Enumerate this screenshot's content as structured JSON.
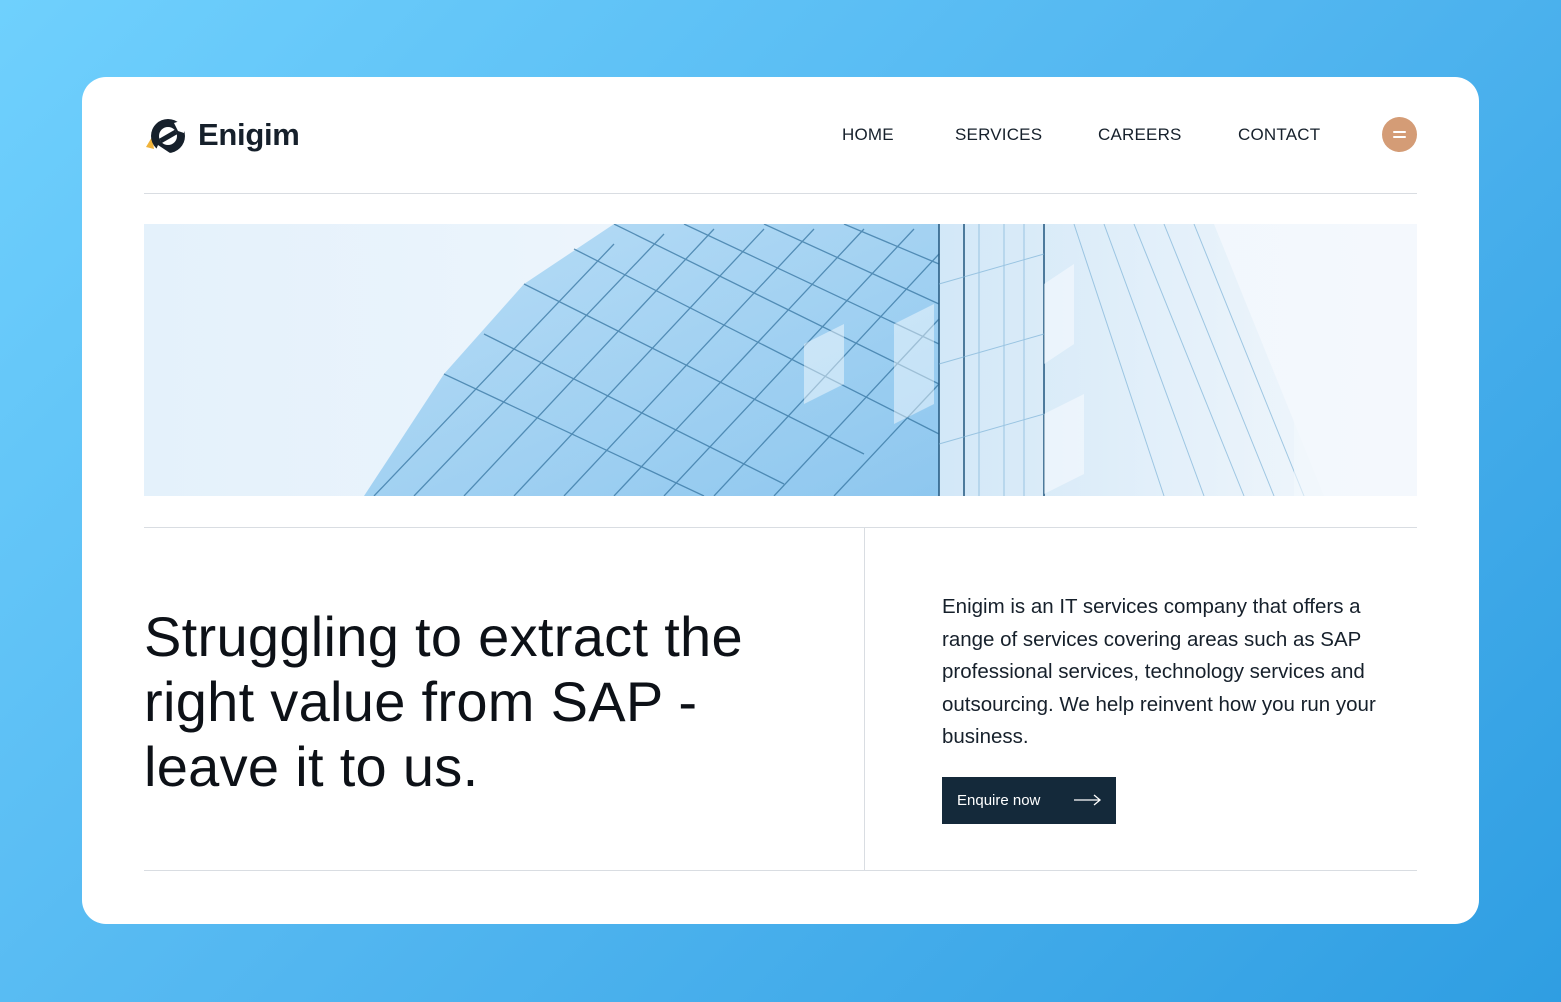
{
  "brand": {
    "name": "Enigim",
    "logo_icon": "enigim-e-logo-icon"
  },
  "nav": {
    "items": [
      {
        "label": "HOME"
      },
      {
        "label": "SERVICES"
      },
      {
        "label": "CAREERS"
      },
      {
        "label": "CONTACT"
      }
    ],
    "menu_icon": "menu-equals-icon",
    "menu_color": "#d49c76"
  },
  "hero": {
    "image": "glass-building-facade"
  },
  "main": {
    "headline": "Struggling to extract the right value from SAP - leave it to us.",
    "description": "Enigim is an IT services company that offers a range of services covering areas such as SAP professional services, technology services and outsourcing. We help reinvent how you run your business.",
    "cta_label": "Enquire now",
    "cta_icon": "arrow-right-icon",
    "cta_color": "#14293a"
  },
  "colors": {
    "background_gradient_start": "#6fd0fd",
    "background_gradient_end": "#2f9ee2",
    "text": "#16202b",
    "accent": "#d49c76"
  }
}
